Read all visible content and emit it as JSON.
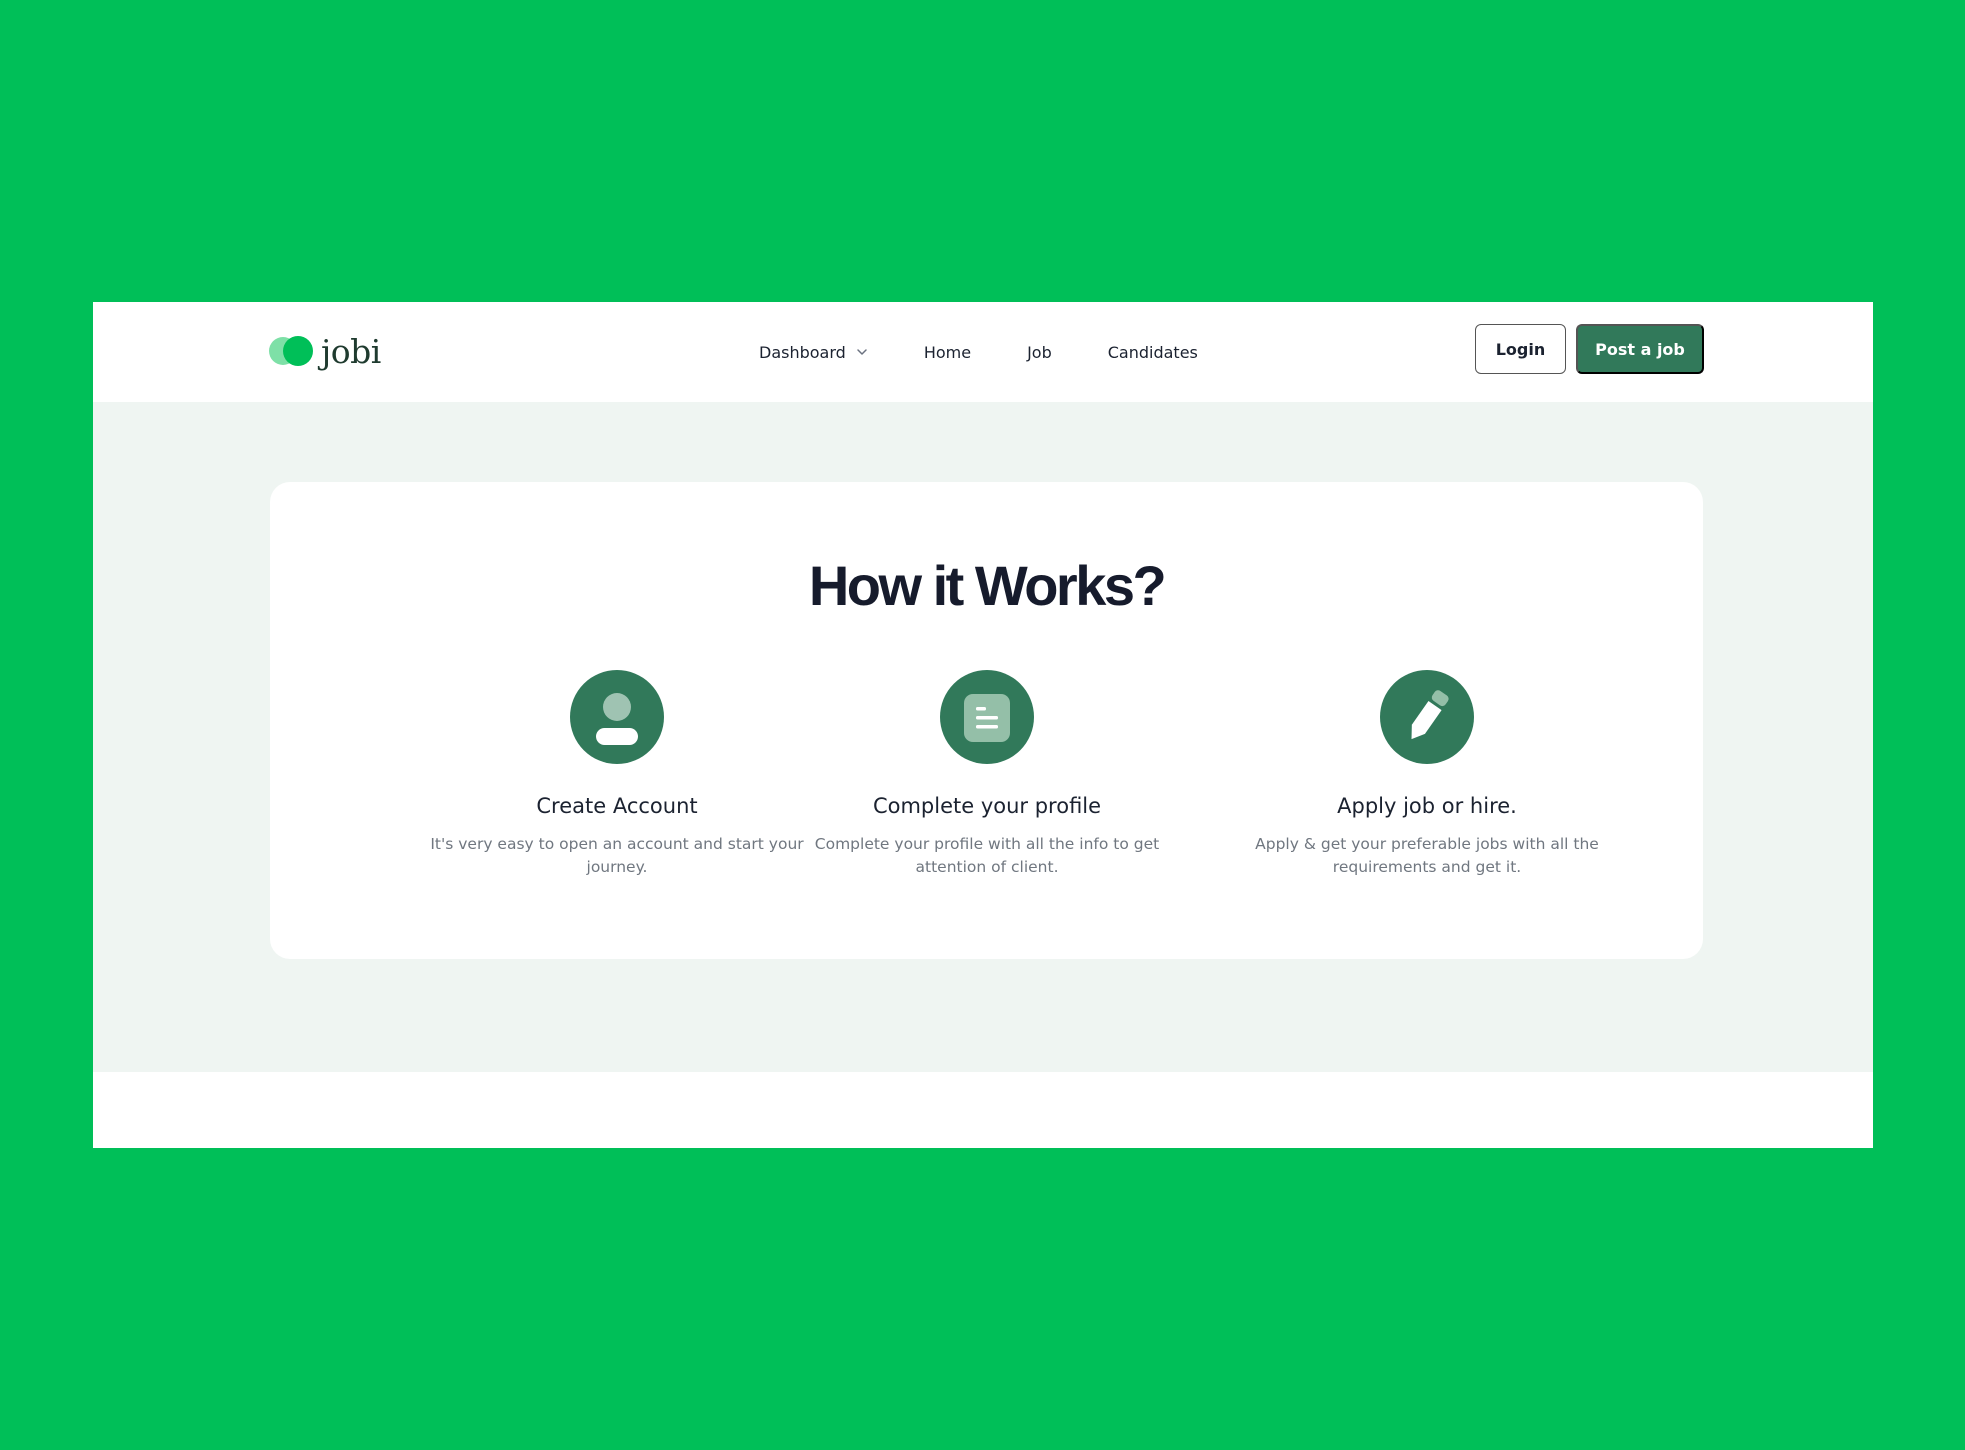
{
  "brand": {
    "logo_text": "jobi",
    "accent_color": "#00BF58",
    "primary_color": "#31795A"
  },
  "nav": {
    "items": [
      {
        "label": "Dashboard",
        "has_dropdown": true
      },
      {
        "label": "Home"
      },
      {
        "label": "Job"
      },
      {
        "label": "Candidates"
      }
    ],
    "login_label": "Login",
    "post_job_label": "Post a job"
  },
  "how_it_works": {
    "title": "How it Works?",
    "steps": [
      {
        "icon": "user-icon",
        "title": "Create Account",
        "description": "It's very easy to open an account and start your journey."
      },
      {
        "icon": "document-icon",
        "title": "Complete your profile",
        "description": "Complete your profile with all the info to get attention of client."
      },
      {
        "icon": "pencil-icon",
        "title": "Apply job or hire.",
        "description": "Apply & get your preferable jobs with all the requirements and get it."
      }
    ]
  }
}
